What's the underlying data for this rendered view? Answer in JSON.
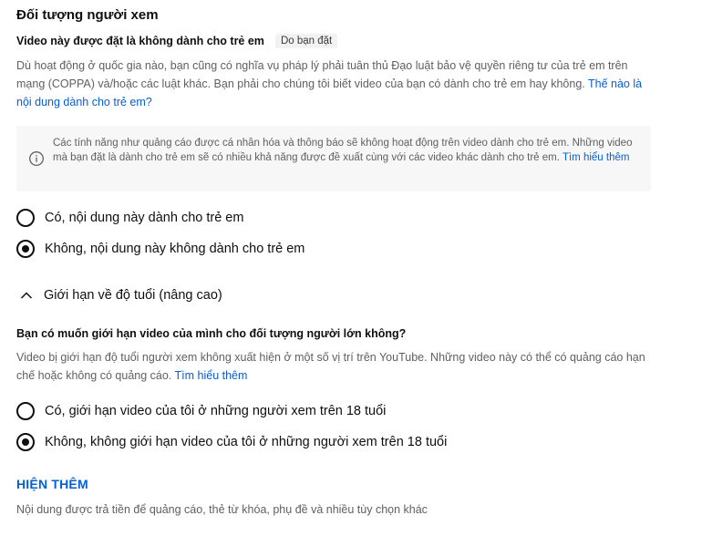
{
  "audience": {
    "title": "Đối tượng người xem",
    "subtitle": "Video này được đặt là không dành cho trẻ em",
    "chip": "Do bạn đặt",
    "description": "Dù hoạt động ở quốc gia nào, bạn cũng có nghĩa vụ pháp lý phải tuân thủ Đạo luật bảo vệ quyền riêng tư của trẻ em trên mạng (COPPA) và/hoặc các luật khác. Bạn phải cho chúng tôi biết video của bạn có dành cho trẻ em hay không.",
    "description_link": "Thế nào là nội dung dành cho trẻ em?",
    "info_text": "Các tính năng như quảng cáo được cá nhân hóa và thông báo sẽ không hoạt động trên video dành cho trẻ em. Những video mà bạn đặt là dành cho trẻ em sẽ có nhiều khả năng được đề xuất cùng với các video khác dành cho trẻ em.",
    "info_link": "Tìm hiểu thêm",
    "options": [
      {
        "label": "Có, nội dung này dành cho trẻ em",
        "checked": false
      },
      {
        "label": "Không, nội dung này không dành cho trẻ em",
        "checked": true
      }
    ]
  },
  "age_restriction": {
    "header": "Giới hạn về độ tuổi (nâng cao)",
    "question": "Bạn có muốn giới hạn video của mình cho đối tượng người lớn không?",
    "description": "Video bị giới hạn độ tuổi người xem không xuất hiện ở một số vị trí trên YouTube. Những video này có thể có quảng cáo hạn chế hoặc không có quảng cáo.",
    "description_link": "Tìm hiểu thêm",
    "options": [
      {
        "label": "Có, giới hạn video của tôi ở những người xem trên 18 tuổi",
        "checked": false
      },
      {
        "label": "Không, không giới hạn video của tôi ở những người xem trên 18 tuổi",
        "checked": true
      }
    ]
  },
  "show_more": {
    "label": "HIỆN THÊM",
    "description": "Nội dung được trả tiền để quảng cáo, thẻ từ khóa, phụ đề và nhiều tùy chọn khác"
  },
  "icons": {
    "info": "info-circle-icon",
    "chevron": "chevron-up-icon"
  },
  "colors": {
    "link": "#065fd4",
    "secondary_text": "#606060",
    "info_bg": "#f7f7f7"
  }
}
